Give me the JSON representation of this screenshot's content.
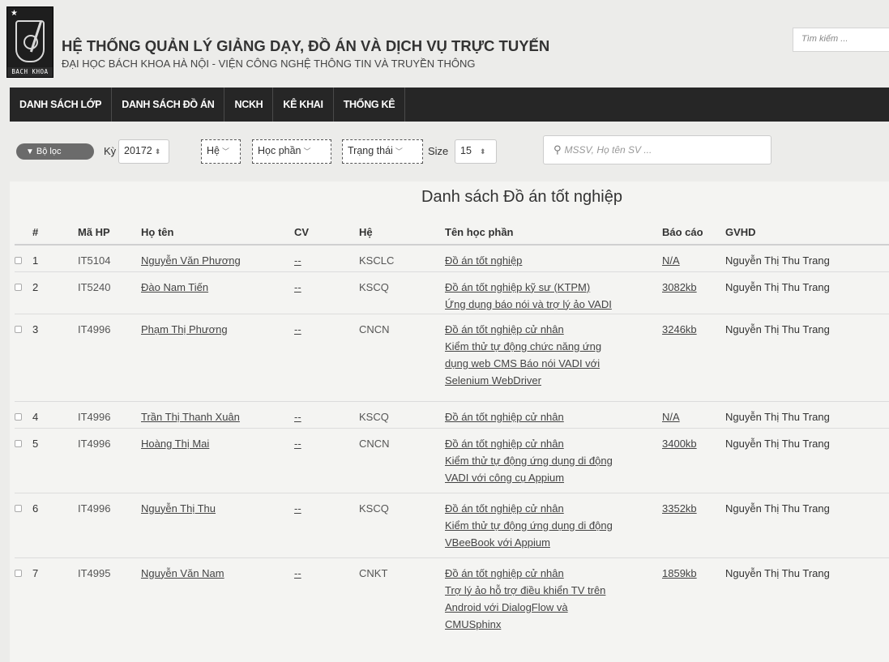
{
  "header": {
    "logo_text": "BACH KHOA",
    "title": "HỆ THỐNG QUẢN LÝ GIẢNG DẠY, ĐỒ ÁN VÀ DỊCH VỤ TRỰC TUYẾN",
    "subtitle": "ĐẠI HỌC BÁCH KHOA HÀ NỘI - VIỆN CÔNG NGHỆ THÔNG TIN VÀ TRUYỀN THÔNG",
    "search_placeholder": "Tìm kiếm ..."
  },
  "nav": {
    "items": [
      "DANH SÁCH LỚP",
      "DANH SÁCH ĐỒ ÁN",
      "NCKH",
      "KÊ KHAI",
      "THỐNG KÊ"
    ]
  },
  "filters": {
    "filter_button": "Bộ lọc",
    "ky_label": "Kỳ",
    "ky_value": "20172",
    "he": "Hệ",
    "hoc_phan": "Học phần",
    "trang_thai": "Trạng thái",
    "size_label": "Size",
    "size_value": "15",
    "search_placeholder": "MSSV, Họ tên SV ..."
  },
  "table": {
    "title": "Danh sách Đồ án tốt nghiệp",
    "columns": [
      "#",
      "Mã HP",
      "Họ tên",
      "CV",
      "Hệ",
      "Tên học phần",
      "Báo cáo",
      "GVHD"
    ],
    "rows": [
      {
        "no": "1",
        "ma_hp": "IT5104",
        "ho_ten": "Nguyễn Văn Phương",
        "cv": "--",
        "he": "KSCLC",
        "ten_hp": [
          "Đồ án tốt nghiệp"
        ],
        "bao_cao": "N/A",
        "gvhd": "Nguyễn Thị Thu Trang"
      },
      {
        "no": "2",
        "ma_hp": "IT5240",
        "ho_ten": "Đào Nam Tiến",
        "cv": "--",
        "he": "KSCQ",
        "ten_hp": [
          "Đồ án tốt nghiệp kỹ sư (KTPM)",
          "Ứng dụng báo nói và trợ lý ảo VADI"
        ],
        "bao_cao": "3082kb",
        "gvhd": "Nguyễn Thị Thu Trang"
      },
      {
        "no": "3",
        "ma_hp": "IT4996",
        "ho_ten": "Phạm Thị Phương",
        "cv": "--",
        "he": "CNCN",
        "ten_hp": [
          "Đồ án tốt nghiệp cử nhân",
          "Kiểm thử tự động chức năng ứng",
          "dụng web CMS Báo nói VADI với",
          "Selenium WebDriver"
        ],
        "bao_cao": "3246kb",
        "gvhd": "Nguyễn Thị Thu Trang"
      },
      {
        "no": "4",
        "ma_hp": "IT4996",
        "ho_ten": "Trần Thị Thanh Xuân",
        "cv": "--",
        "he": "KSCQ",
        "ten_hp": [
          "Đồ án tốt nghiệp cử nhân"
        ],
        "bao_cao": "N/A",
        "gvhd": "Nguyễn Thị Thu Trang"
      },
      {
        "no": "5",
        "ma_hp": "IT4996",
        "ho_ten": "Hoàng Thị Mai",
        "cv": "--",
        "he": "CNCN",
        "ten_hp": [
          "Đồ án tốt nghiệp cử nhân",
          "Kiểm thử tự động ứng dụng di động",
          "VADI với công cụ Appium"
        ],
        "bao_cao": "3400kb",
        "gvhd": "Nguyễn Thị Thu Trang"
      },
      {
        "no": "6",
        "ma_hp": "IT4996",
        "ho_ten": "Nguyễn Thị Thu",
        "cv": "--",
        "he": "KSCQ",
        "ten_hp": [
          "Đồ án tốt nghiệp cử nhân",
          "Kiểm thử tự động ứng dụng di động",
          "VBeeBook với Appium"
        ],
        "bao_cao": "3352kb",
        "gvhd": "Nguyễn Thị Thu Trang"
      },
      {
        "no": "7",
        "ma_hp": "IT4995",
        "ho_ten": "Nguyễn Văn Nam",
        "cv": "--",
        "he": "CNKT",
        "ten_hp": [
          "Đồ án tốt nghiệp cử nhân",
          "Trợ lý ảo hỗ trợ điều khiển TV trên",
          "Android với DialogFlow và",
          "CMUSphinx"
        ],
        "bao_cao": "1859kb",
        "gvhd": "Nguyễn Thị Thu Trang"
      }
    ]
  }
}
